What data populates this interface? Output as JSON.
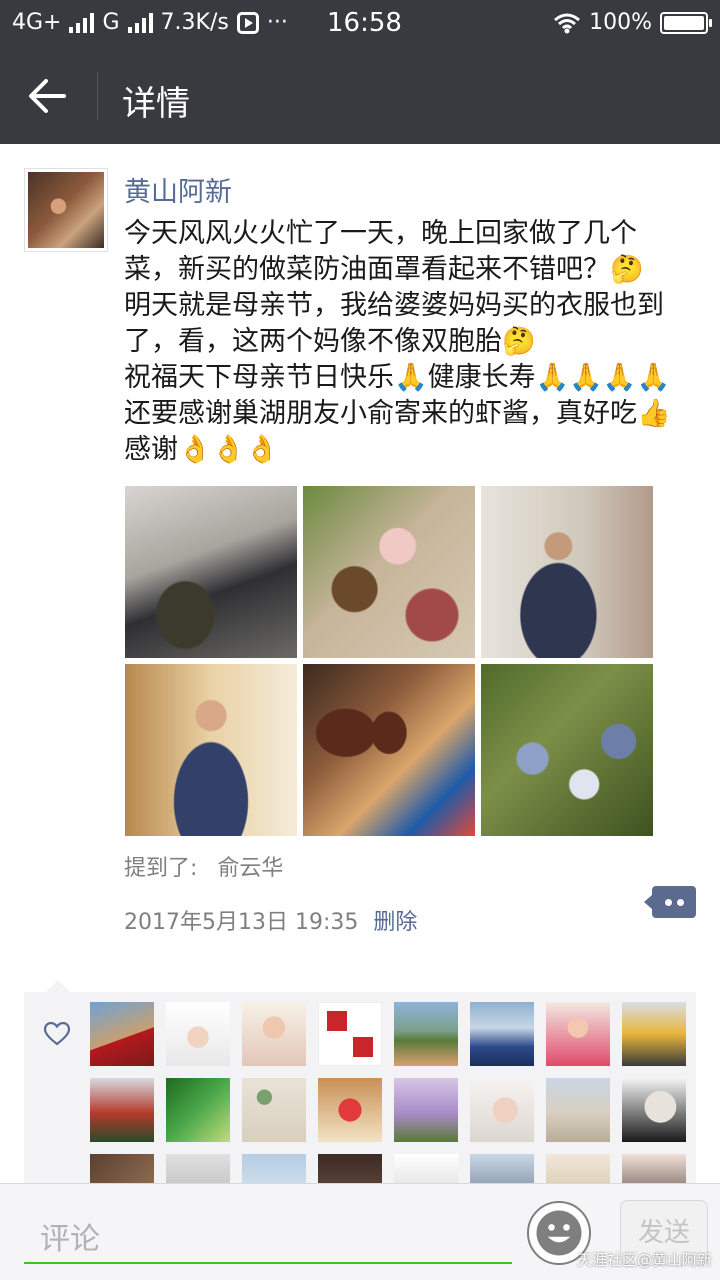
{
  "status_bar": {
    "network_1": "4G+",
    "network_2": "G",
    "speed": "7.3K/s",
    "more": "···",
    "time": "16:58",
    "battery": "100%"
  },
  "nav": {
    "title": "详情",
    "back_icon": "arrow-left-icon"
  },
  "post": {
    "author": "黄山阿新",
    "text_lines": [
      "今天风风火火忙了一天，晚上回家做了几个",
      "菜，新买的做菜防油面罩看起来不错吧？🤔",
      "明天就是母亲节，我给婆婆妈妈买的衣服也到",
      "了，看，这两个妈像不像双胞胎🤔",
      "祝福天下母亲节日快乐🙏健康长寿🙏🙏🙏🙏",
      "还要感谢巢湖朋友小俞寄来的虾酱，真好吃👍",
      "感谢👌👌👌"
    ],
    "mention_label": "提到了:",
    "mention_name": "俞云华",
    "timestamp": "2017年5月13日 19:35",
    "delete_label": "删除"
  },
  "likes": {
    "heart_icon": "heart-outline-icon"
  },
  "bottom_bar": {
    "comment_placeholder": "评论",
    "send_label": "发送",
    "watermark": "天涯社区@黄山阿新"
  },
  "colors": {
    "bar_bg": "#393a3f",
    "link": "#576b95",
    "accent_green": "#45c01a"
  }
}
